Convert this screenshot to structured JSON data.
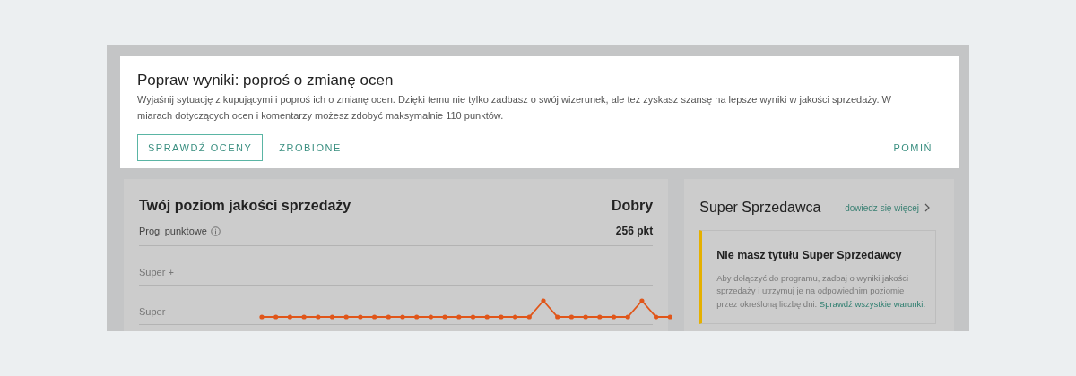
{
  "banner": {
    "title": "Popraw wyniki: poproś o zmianę ocen",
    "text": "Wyjaśnij sytuację z kupującymi i poproś ich o zmianę ocen. Dzięki temu nie tylko zadbasz o swój wizerunek, ale też zyskasz szansę na lepsze wyniki w jakości sprzedaży. W miarach dotyczących ocen i komentarzy możesz zdobyć maksymalnie 110 punktów.",
    "buttons": [
      {
        "label": "SPRAWDŹ OCENY",
        "kind": "outlined"
      },
      {
        "label": "ZROBIONE",
        "kind": "text"
      }
    ],
    "skip": "POMIŃ"
  },
  "quality": {
    "title": "Twój poziom jakości sprzedaży",
    "level_name": "Dobry",
    "thresholds_label": "Progi punktowe",
    "points": "256 pkt",
    "levels": [
      "Super +",
      "Super"
    ]
  },
  "super_seller": {
    "title": "Super Sprzedawca",
    "more_link": "dowiedz się więcej",
    "notice": {
      "title": "Nie masz tytułu Super Sprzedawcy",
      "text": "Aby dołączyć do programu, zadbaj o wyniki jakości sprzedaży i utrzymuj je na odpowiednim poziomie przez określoną liczbę dni.",
      "link": "Sprawdź wszystkie warunki."
    }
  }
}
